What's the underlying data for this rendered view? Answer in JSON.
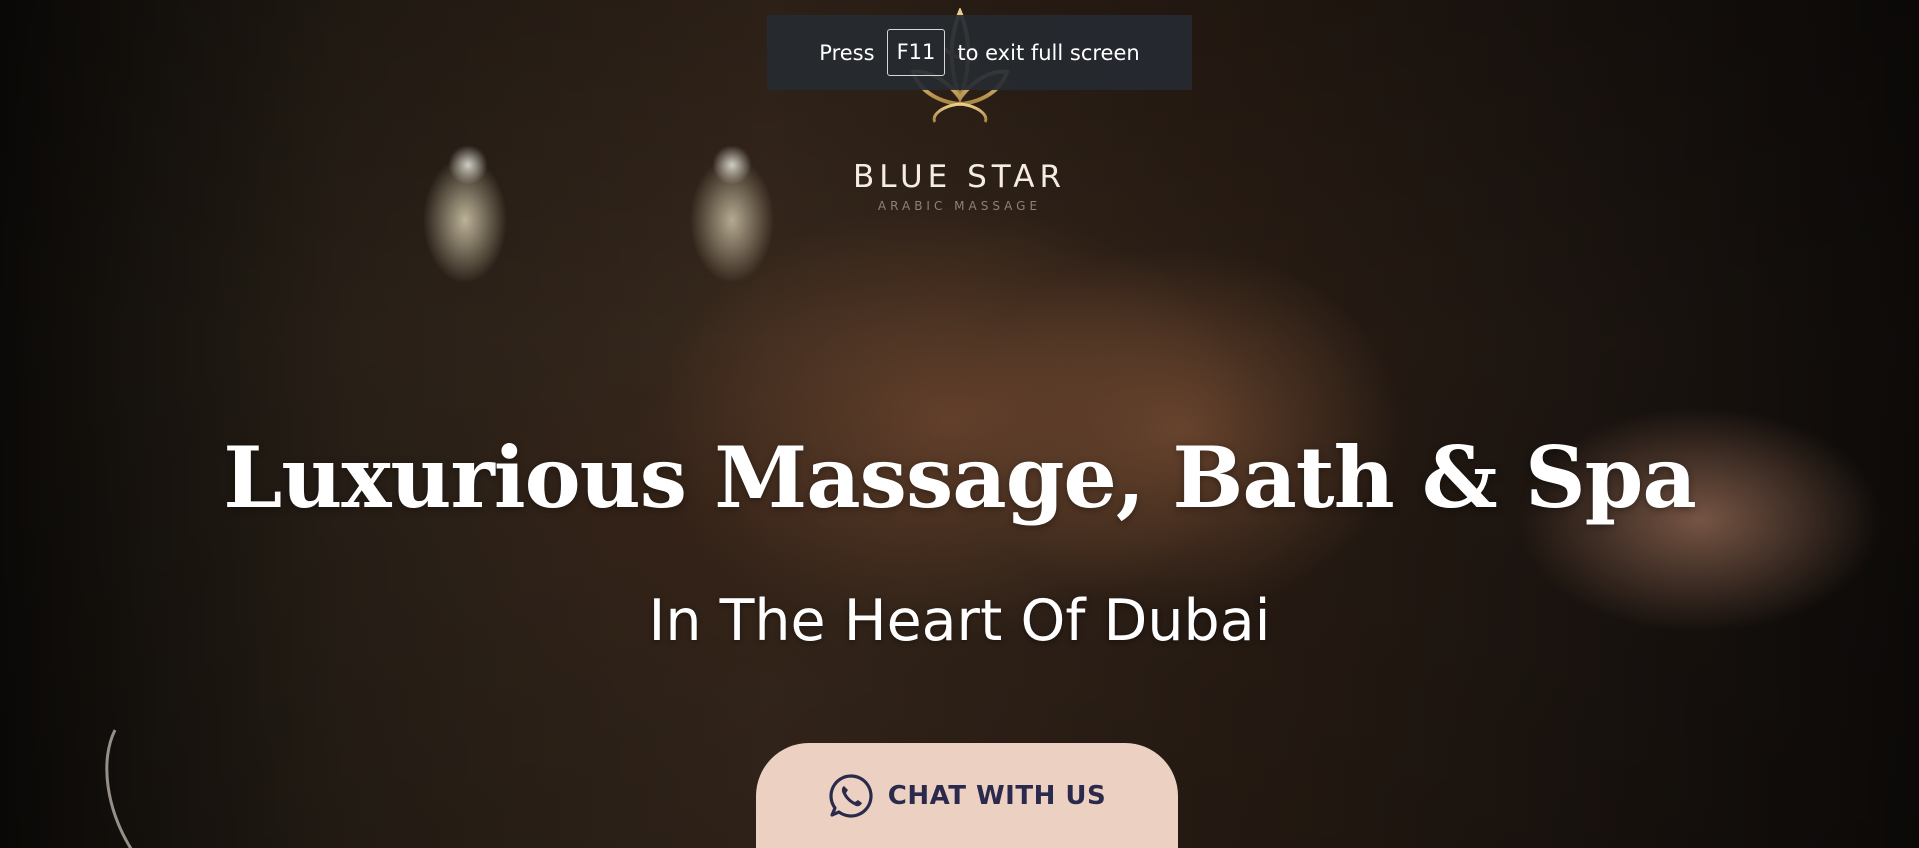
{
  "fullscreen_notice": {
    "prefix": "Press",
    "key": "F11",
    "suffix": "to exit full screen"
  },
  "brand": {
    "name": "BLUE STAR",
    "tagline": "ARABIC MASSAGE"
  },
  "hero": {
    "headline": "Luxurious Massage, Bath & Spa",
    "subheadline": "In The Heart Of Dubai"
  },
  "cta": {
    "label": "CHAT WITH US"
  },
  "colors": {
    "button_bg": "#ecd1c2",
    "button_text": "#2b2a4c",
    "logo_gold": "#c9a45c"
  },
  "icons": [
    "lotus-logo-icon",
    "whatsapp-icon"
  ]
}
